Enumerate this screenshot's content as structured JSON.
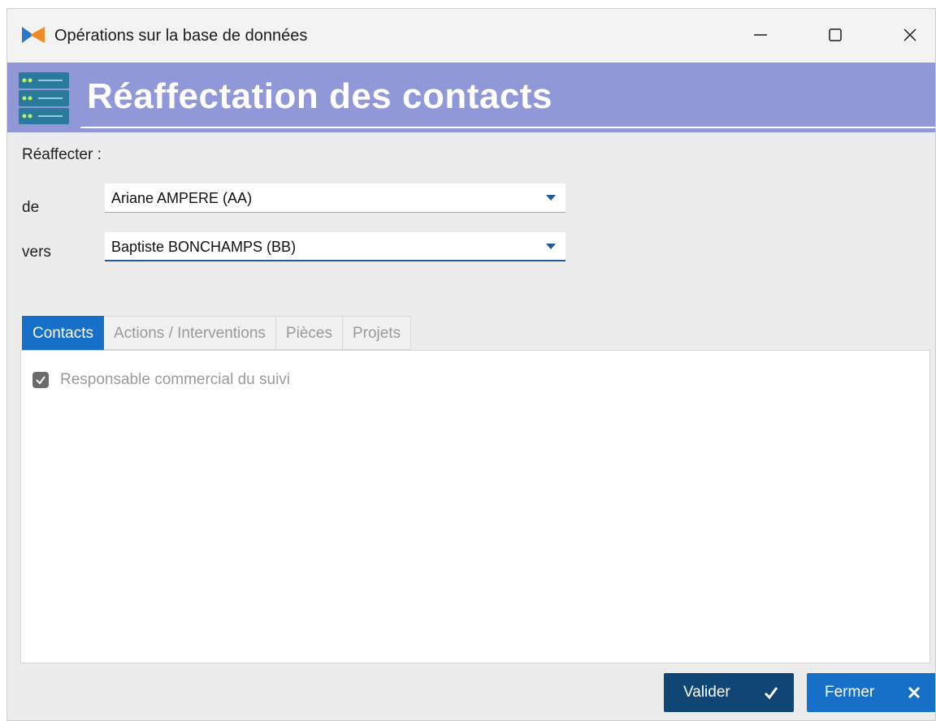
{
  "window": {
    "title": "Opérations sur la base de données",
    "app_icon": "app-logo-icon",
    "controls": [
      "minimize-icon",
      "maximize-icon",
      "close-icon"
    ]
  },
  "header": {
    "icon": "database-server-icon",
    "title": "Réaffectation des contacts",
    "background": "#9198d8"
  },
  "form": {
    "reaffecter_label": "Réaffecter :",
    "de_label": "de",
    "de_value": "Ariane AMPERE (AA)",
    "vers_label": "vers",
    "vers_value": "Baptiste BONCHAMPS (BB)"
  },
  "tabs": [
    {
      "label": "Contacts",
      "active": true
    },
    {
      "label": "Actions / Interventions",
      "active": false
    },
    {
      "label": "Pièces",
      "active": false
    },
    {
      "label": "Projets",
      "active": false
    }
  ],
  "contacts_tab": {
    "checkbox_label": "Responsable commercial du suivi",
    "checked": true
  },
  "footer": {
    "valider_label": "Valider",
    "valider_icon": "checkmark-icon",
    "fermer_label": "Fermer",
    "fermer_icon": "close-x-icon"
  },
  "colors": {
    "accent": "#1670c7",
    "primary_dark": "#0f4675",
    "banner": "#9198d8"
  }
}
